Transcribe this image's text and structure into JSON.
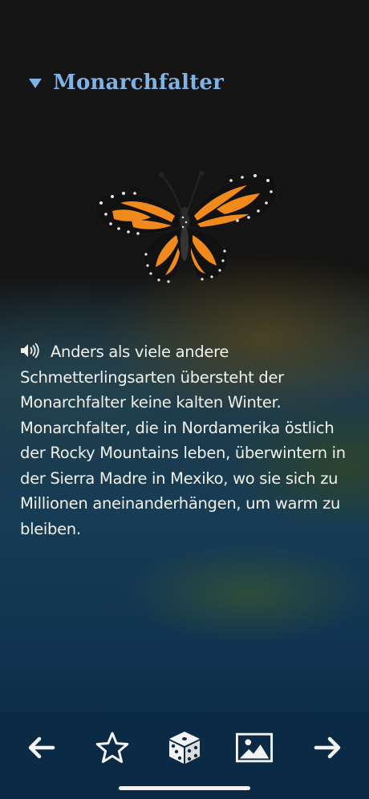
{
  "header": {
    "title": "Monarchfalter",
    "collapse_icon": "triangle-down-icon"
  },
  "image": {
    "subject": "monarch-butterfly-icon"
  },
  "content": {
    "audio_icon": "speaker-icon",
    "text": "Anders als viele andere Schmetterlingsarten übersteht der Monarchfalter keine kalten Winter. Monarchfalter, die in Nordamerika östlich der Rocky Mountains leben, überwintern in der Sierra Madre in Mexiko, wo sie sich zu Millionen aneinanderhängen, um warm zu bleiben."
  },
  "toolbar": {
    "buttons": [
      {
        "icon": "arrow-left-icon"
      },
      {
        "icon": "star-icon"
      },
      {
        "icon": "dice-icon"
      },
      {
        "icon": "image-icon"
      },
      {
        "icon": "arrow-right-icon"
      }
    ]
  },
  "colors": {
    "title": "#7fb3e6",
    "text": "#f1f1ea",
    "toolbar_bg": "#0b2a45",
    "butterfly_orange": "#f08a1c"
  }
}
